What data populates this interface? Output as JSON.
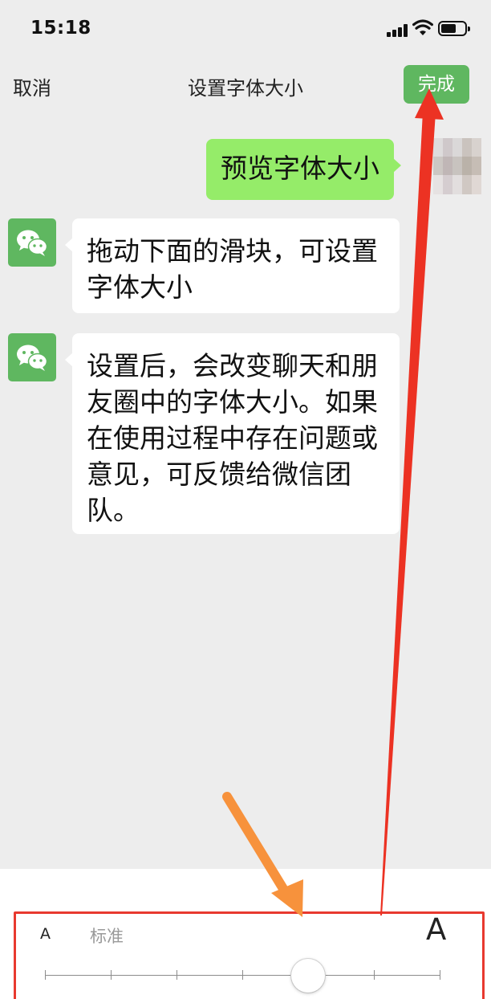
{
  "status_bar": {
    "time": "15:18"
  },
  "nav": {
    "cancel_label": "取消",
    "title": "设置字体大小",
    "done_label": "完成"
  },
  "chat": {
    "self_message": "预览字体大小",
    "messages": [
      {
        "text": "拖动下面的滑块，可设置字体大小"
      },
      {
        "text": "设置后，会改变聊天和朋友圈中的字体大小。如果在使用过程中存在问题或意见，可反馈给微信团队。"
      }
    ]
  },
  "font_size": {
    "small_a": "A",
    "current_label": "标准",
    "large_a": "A",
    "tick_count": 7,
    "selected_index": 4
  },
  "colors": {
    "accent_green": "#5fb760",
    "self_bubble": "#95ec69",
    "highlight_red": "#e8392f",
    "arrow_orange": "#f7923c"
  },
  "icons": {
    "avatar": "wechat-logo-icon",
    "signal": "cellular-signal-icon",
    "wifi": "wifi-icon",
    "battery": "battery-icon"
  }
}
